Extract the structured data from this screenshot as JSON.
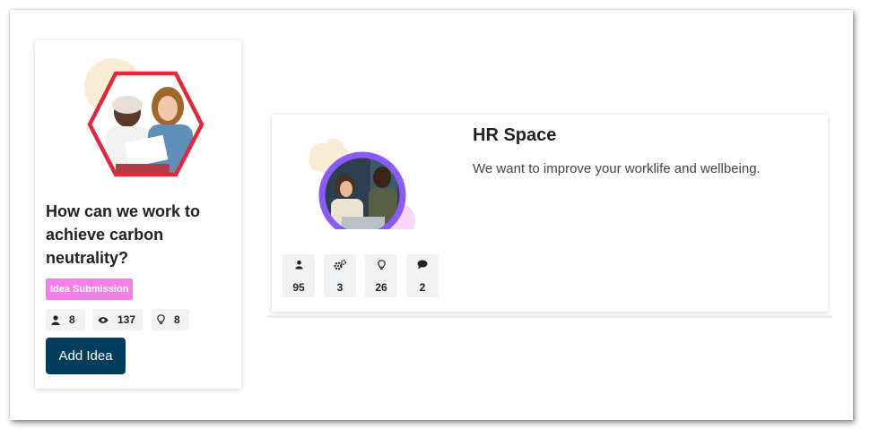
{
  "idea_card": {
    "title": "How can we work to achieve carbon neutrality?",
    "badge": "Idea Submission",
    "stats": [
      {
        "icon": "user-icon",
        "value": "8"
      },
      {
        "icon": "eye-icon",
        "value": "137"
      },
      {
        "icon": "lightbulb-icon",
        "value": "8"
      }
    ],
    "button_label": "Add Idea",
    "colors": {
      "hexagon": "#e0293a",
      "badge": "#f57fe8",
      "button": "#003d5c",
      "blob": "#f9ecd6"
    }
  },
  "space_card": {
    "title": "HR Space",
    "description": "We want to improve your worklife and wellbeing.",
    "stats": [
      {
        "icon": "user-icon",
        "value": "95"
      },
      {
        "icon": "gears-icon",
        "value": "3"
      },
      {
        "icon": "lightbulb-icon",
        "value": "26"
      },
      {
        "icon": "comment-icon",
        "value": "2"
      }
    ],
    "colors": {
      "ring": "#8a5cf5",
      "blob_pink": "#f7d6fa",
      "blob_beige": "#f9ecd6"
    }
  }
}
